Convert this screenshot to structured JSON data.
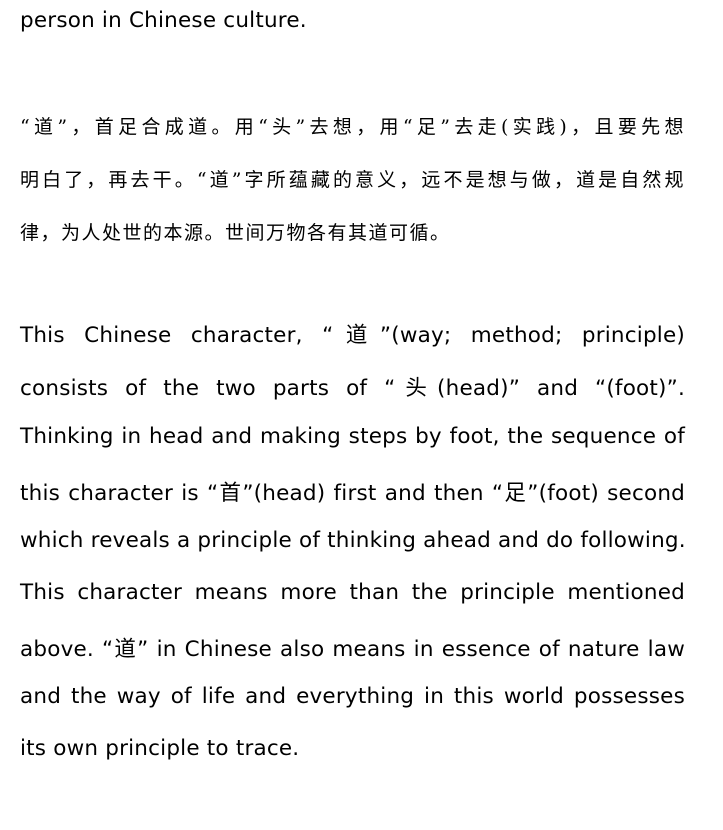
{
  "document": {
    "top_fragment": "person in Chinese culture.",
    "chinese_paragraph": [
      "“道”，首足合成道。用“头”去想，用“足”去走(实践)，且要先想",
      "明白了，再去干。“道”字所蕴藏的意义，远不是想与做，道是自然规",
      "律，为人处世的本源。世间万物各有其道可循。"
    ],
    "english_paragraph": [
      "This Chinese character, “道”(way; method; principle)",
      "consists of the two parts of “头(head)” and “(foot)”.",
      "Thinking in head and making steps by foot, the sequence of",
      "this character is “首”(head) first and then “足”(foot) second",
      "which reveals a principle of thinking ahead and do following.",
      "This character means more than the principle mentioned",
      "above. “道” in Chinese also means in essence of nature law",
      "and the way of life and everything in this world possesses",
      "its own principle to trace."
    ]
  }
}
